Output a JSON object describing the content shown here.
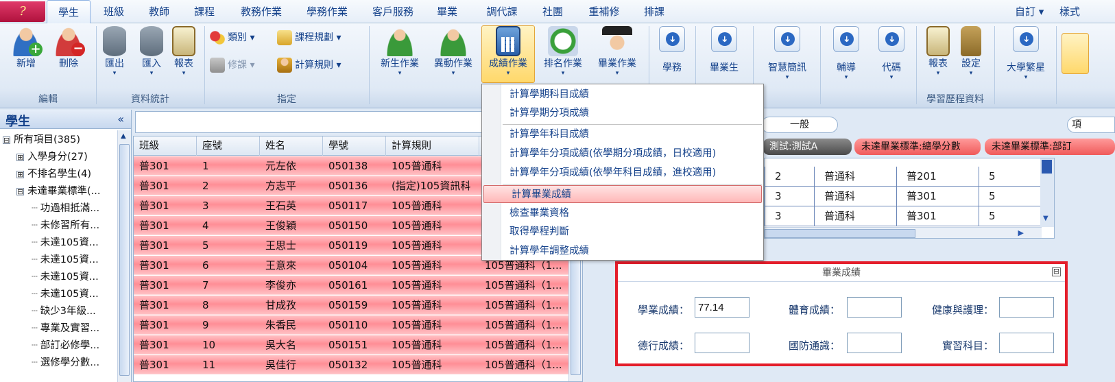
{
  "app": {
    "logo_text": "?"
  },
  "menu_tabs": [
    "學生",
    "班級",
    "教師",
    "課程",
    "教務作業",
    "學務作業",
    "客戶服務",
    "畢業",
    "調代課",
    "社團",
    "重補修",
    "排課"
  ],
  "menu_right": {
    "customize": "自訂",
    "arrow": "▾",
    "style": "樣式"
  },
  "ribbon": {
    "edit": {
      "add": "新增",
      "delete": "刪除",
      "group": "編輯"
    },
    "stats": {
      "export": "匯出",
      "import": "匯入",
      "report": "報表",
      "group": "資料統計"
    },
    "assign": {
      "category": "類別",
      "course_plan": "課程規劃",
      "repeat_course": "修課",
      "calc_rules": "計算規則",
      "group": "指定",
      "arrow": "▾"
    },
    "jobs": {
      "new_student": "新生作業",
      "change": "異動作業",
      "score": "成績作業",
      "ranking": "排名作業",
      "graduation": "畢業作業"
    },
    "buttons": {
      "student_affairs": "學務",
      "graduates": "畢業生",
      "smart_sms": "智慧簡訊",
      "counseling": "輔導",
      "code": "代碼"
    },
    "learning": {
      "report": "報表",
      "settings": "設定",
      "group": "學習歷程資料"
    },
    "college": {
      "label": "大學繁星"
    },
    "dropdown_arrow": "▾"
  },
  "left_panel": {
    "title": "學生",
    "collapse": "«",
    "tree": [
      {
        "expander": "⊟",
        "label": "所有項目(385)"
      },
      {
        "expander": "⊞",
        "label": "入學身分(27)"
      },
      {
        "expander": "⊞",
        "label": "不排名學生(4)"
      },
      {
        "expander": "⊟",
        "label": "未達畢業標準(..."
      },
      {
        "label": "功過相抵滿..."
      },
      {
        "label": "未修習所有..."
      },
      {
        "label": "未達105資..."
      },
      {
        "label": "未達105資..."
      },
      {
        "label": "未達105資..."
      },
      {
        "label": "未達105資..."
      },
      {
        "label": "缺少3年級..."
      },
      {
        "label": "專業及實習..."
      },
      {
        "label": "部訂必修學..."
      },
      {
        "label": "選修學分數..."
      }
    ],
    "tree_branch": "┄",
    "scroll_up": "▲"
  },
  "grid": {
    "columns": [
      "班級",
      "座號",
      "姓名",
      "學號",
      "計算規則"
    ],
    "rows": [
      {
        "class": "普301",
        "seat": "1",
        "name": "元左依",
        "id": "050138",
        "rule": "105普通科",
        "extra": ""
      },
      {
        "class": "普301",
        "seat": "2",
        "name": "方志平",
        "id": "050136",
        "rule": "(指定)105資訊科",
        "extra": ""
      },
      {
        "class": "普301",
        "seat": "3",
        "name": "王石英",
        "id": "050117",
        "rule": "105普通科",
        "extra": ""
      },
      {
        "class": "普301",
        "seat": "4",
        "name": "王俊穎",
        "id": "050150",
        "rule": "105普通科",
        "extra": ""
      },
      {
        "class": "普301",
        "seat": "5",
        "name": "王思士",
        "id": "050119",
        "rule": "105普通科",
        "extra": ""
      },
      {
        "class": "普301",
        "seat": "6",
        "name": "王意來",
        "id": "050104",
        "rule": "105普通科",
        "extra": "105普通科（1..."
      },
      {
        "class": "普301",
        "seat": "7",
        "name": "李俊亦",
        "id": "050161",
        "rule": "105普通科",
        "extra": "105普通科（1..."
      },
      {
        "class": "普301",
        "seat": "8",
        "name": "甘成孜",
        "id": "050159",
        "rule": "105普通科",
        "extra": "105普通科（1..."
      },
      {
        "class": "普301",
        "seat": "9",
        "name": "朱香民",
        "id": "050110",
        "rule": "105普通科",
        "extra": "105普通科（1..."
      },
      {
        "class": "普301",
        "seat": "10",
        "name": "吳大名",
        "id": "050151",
        "rule": "105普通科",
        "extra": "105普通科（1..."
      },
      {
        "class": "普301",
        "seat": "11",
        "name": "吳佳行",
        "id": "050132",
        "rule": "105普通科",
        "extra": "105普通科（1..."
      }
    ]
  },
  "score_menu": {
    "items": [
      "計算學期科目成績",
      "計算學期分項成績",
      "計算學年科目成績",
      "計算學年分項成績(依學期分項成績，日校適用)",
      "計算學年分項成績(依學年科目成績，進校適用)",
      "計算畢業成績",
      "檢查畢業資格",
      "取得學程判斷",
      "計算學年調整成績"
    ]
  },
  "right": {
    "general_tab": "一般",
    "cut_label": "項",
    "filter_tabs": [
      "測試:測試A",
      "未達畢業標準:總學分數",
      "未達畢業標準:部訂"
    ],
    "sub_rows": [
      {
        "c1": "2",
        "c2": "普通科",
        "c3": "普201",
        "c4": "5"
      },
      {
        "c1": "3",
        "c2": "普通科",
        "c3": "普301",
        "c4": "5"
      },
      {
        "c1": "3",
        "c2": "普通科",
        "c3": "普301",
        "c4": "5"
      }
    ],
    "scroll_right": "▶",
    "scroll_down": "▼"
  },
  "graduation_panel": {
    "title": "畢業成績",
    "minimize": "⊟",
    "fields": {
      "academic": {
        "label": "學業成績：",
        "value": "77.14"
      },
      "pe": {
        "label": "體育成績：",
        "value": ""
      },
      "health": {
        "label": "健康與護理：",
        "value": ""
      },
      "conduct": {
        "label": "德行成績：",
        "value": ""
      },
      "defense": {
        "label": "國防通識：",
        "value": ""
      },
      "practice": {
        "label": "實習科目：",
        "value": ""
      }
    }
  },
  "colors": {
    "accent": "#15428b",
    "highlight_border": "#e41e2b",
    "row_pink": "#ff8e96"
  }
}
